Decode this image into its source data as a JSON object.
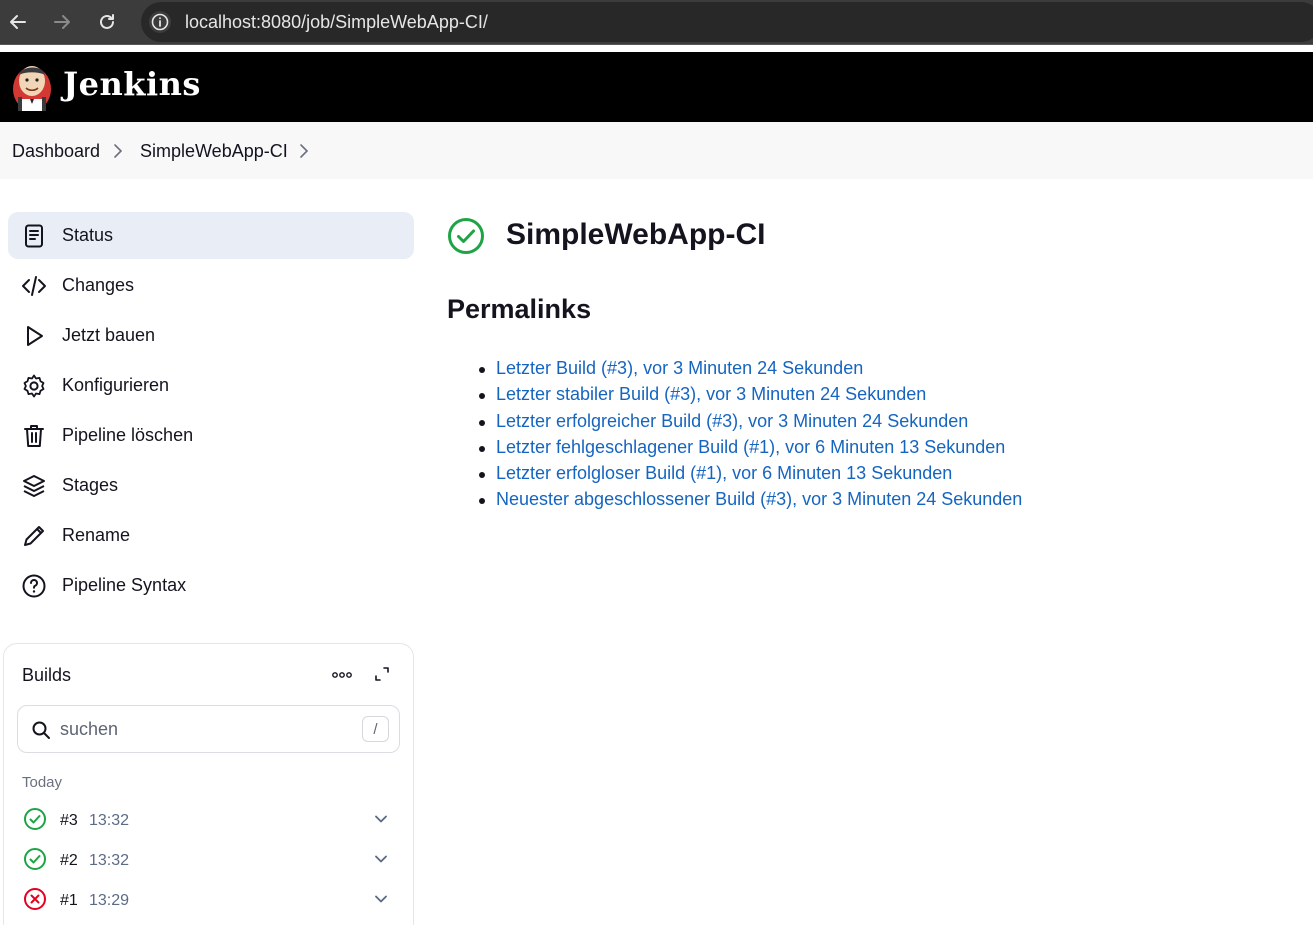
{
  "browser": {
    "url": "localhost:8080/job/SimpleWebApp-CI/"
  },
  "header": {
    "brand": "Jenkins"
  },
  "breadcrumb": {
    "items": [
      "Dashboard",
      "SimpleWebApp-CI"
    ]
  },
  "sidebar": {
    "items": [
      {
        "label": "Status",
        "icon": "document-icon",
        "active": true
      },
      {
        "label": "Changes",
        "icon": "code-icon"
      },
      {
        "label": "Jetzt bauen",
        "icon": "play-icon"
      },
      {
        "label": "Konfigurieren",
        "icon": "gear-icon"
      },
      {
        "label": "Pipeline löschen",
        "icon": "trash-icon"
      },
      {
        "label": "Stages",
        "icon": "layers-icon"
      },
      {
        "label": "Rename",
        "icon": "pencil-icon"
      },
      {
        "label": "Pipeline Syntax",
        "icon": "help-icon"
      }
    ]
  },
  "builds": {
    "title": "Builds",
    "search_placeholder": "suchen",
    "shortcut_key": "/",
    "group_label": "Today",
    "items": [
      {
        "number": "#3",
        "time": "13:32",
        "status": "success"
      },
      {
        "number": "#2",
        "time": "13:32",
        "status": "success"
      },
      {
        "number": "#1",
        "time": "13:29",
        "status": "failure"
      }
    ]
  },
  "main": {
    "job_title": "SimpleWebApp-CI",
    "permalinks_heading": "Permalinks",
    "permalinks": [
      "Letzter Build (#3), vor 3 Minuten 24 Sekunden",
      "Letzter stabiler Build (#3), vor 3 Minuten 24 Sekunden",
      "Letzter erfolgreicher Build (#3), vor 3 Minuten 24 Sekunden",
      "Letzter fehlgeschlagener Build (#1), vor 6 Minuten 13 Sekunden",
      "Letzter erfolgloser Build (#1), vor 6 Minuten 13 Sekunden",
      "Neuester abgeschlossener Build (#3), vor 3 Minuten 24 Sekunden"
    ]
  },
  "colors": {
    "success": "#1ea446",
    "failure": "#e6001f",
    "link": "#1565c0",
    "header_bg": "#000000"
  }
}
